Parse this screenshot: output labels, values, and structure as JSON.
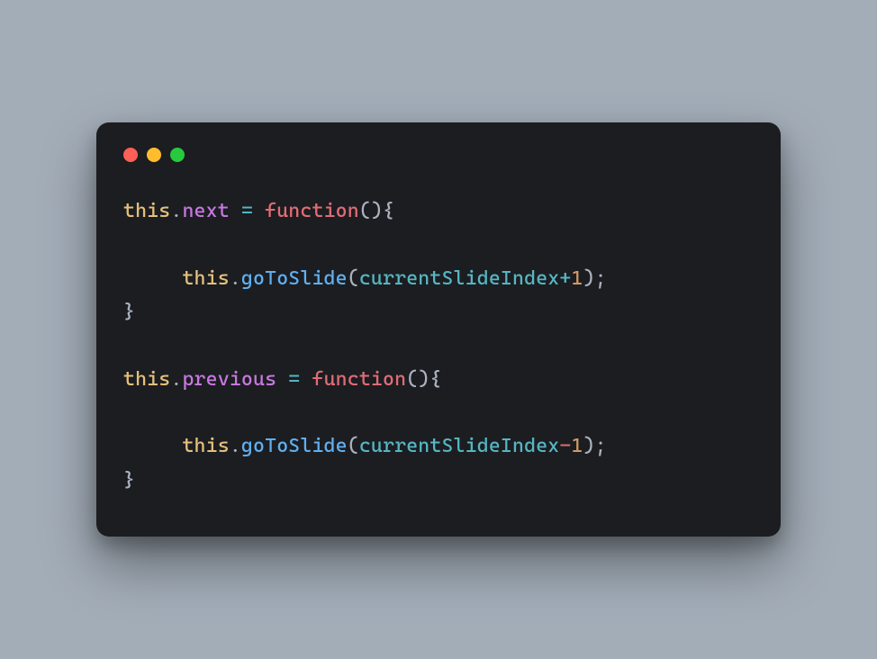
{
  "window": {
    "controls": {
      "close": "red",
      "minimize": "yellow",
      "zoom": "green"
    }
  },
  "code": {
    "l1": {
      "this": "this",
      "dot1": ".",
      "prop": "next",
      "sp1": " ",
      "eq": "=",
      "sp2": " ",
      "kw": "function",
      "paren": "(){"
    },
    "l2": "",
    "l3": {
      "indent": "     ",
      "this": "this",
      "dot1": ".",
      "method": "goToSlide",
      "open": "(",
      "ident": "currentSlideIndex",
      "op": "+",
      "num": "1",
      "close": ");"
    },
    "l4": "}",
    "l5": "",
    "l6": {
      "this": "this",
      "dot1": ".",
      "prop": "previous",
      "sp1": " ",
      "eq": "=",
      "sp2": " ",
      "kw": "function",
      "paren": "(){"
    },
    "l7": "",
    "l8": {
      "indent": "     ",
      "this": "this",
      "dot1": ".",
      "method": "goToSlide",
      "open": "(",
      "ident": "currentSlideIndex",
      "op": "-",
      "num": "1",
      "close": ");"
    },
    "l9": "}"
  }
}
